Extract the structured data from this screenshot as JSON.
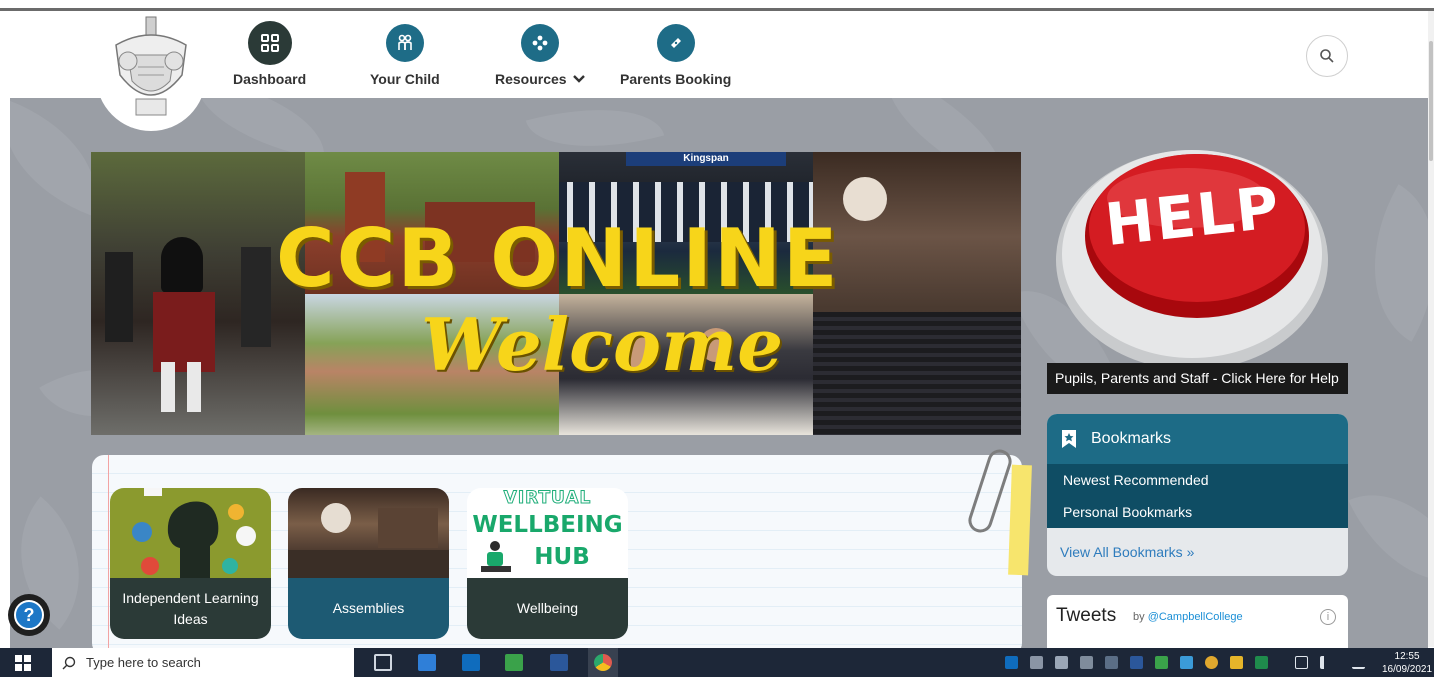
{
  "nav": {
    "items": [
      {
        "label": "Dashboard"
      },
      {
        "label": "Your Child"
      },
      {
        "label": "Resources"
      },
      {
        "label": "Parents Booking"
      }
    ]
  },
  "banner": {
    "title": "CCB ONLINE",
    "subtitle": "Welcome",
    "stadium_sign": "Kingspan"
  },
  "cards": [
    {
      "label": "Independent Learning Ideas"
    },
    {
      "label": "Assemblies"
    },
    {
      "label": "Wellbeing"
    }
  ],
  "wellbeing_image": {
    "line1": "VIRTUAL",
    "line2": "WELLBEING",
    "line3": "HUB"
  },
  "help": {
    "button_text": "HELP",
    "caption": "Pupils, Parents and Staff - Click Here for Help"
  },
  "bookmarks": {
    "title": "Bookmarks",
    "items": [
      "Newest Recommended",
      "Personal Bookmarks"
    ],
    "view_all": "View All Bookmarks »"
  },
  "tweets": {
    "title": "Tweets",
    "by_prefix": "by",
    "handle": "@CampbellCollege",
    "info_icon": "i"
  },
  "help_float": "?",
  "taskbar": {
    "search_placeholder": "Type here to search",
    "time": "12:55",
    "date": "16/09/2021"
  },
  "colors": {
    "nav_dark": "#2b3a37",
    "nav_teal": "#1e6c87",
    "banner_yellow": "#f7d51a",
    "bookmark_head": "#1d6b86",
    "bookmark_item": "#0f4d64",
    "link_blue": "#2e7cbd"
  }
}
